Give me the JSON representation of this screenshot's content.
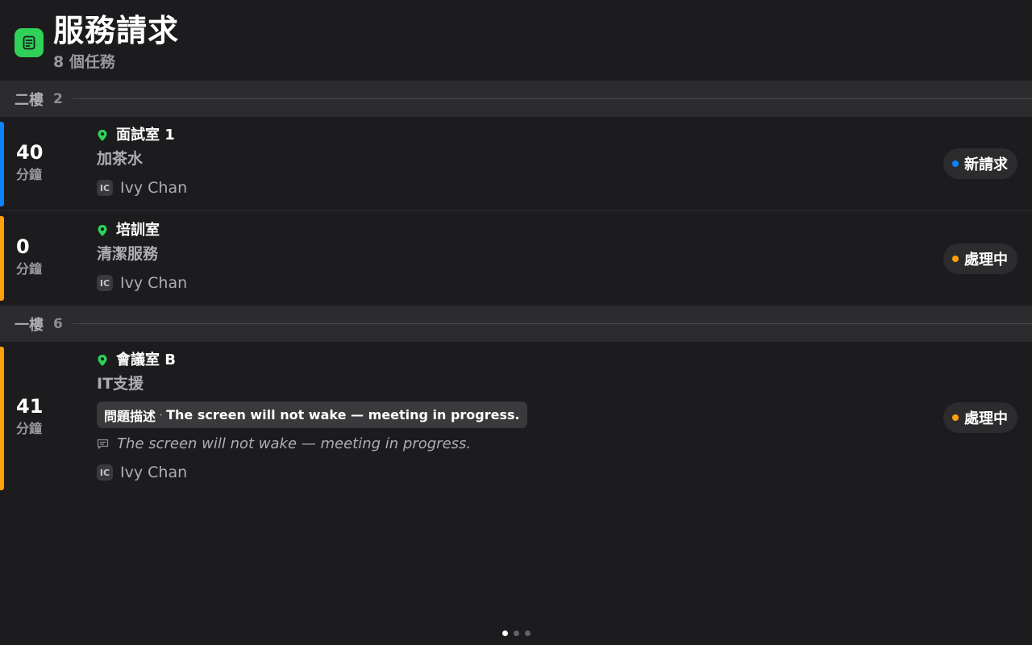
{
  "header": {
    "title": "服務請求",
    "task_count": "8 個任務",
    "icon": "note-icon",
    "icon_color": "#30d158"
  },
  "colors": {
    "new": "#0a84ff",
    "in_progress": "#ff9f0a",
    "location_pin": "#30d158"
  },
  "sections": [
    {
      "name": "二樓",
      "count": "2",
      "rows": [
        {
          "minutes": "40",
          "minutes_unit": "分鐘",
          "location": "面試室 1",
          "service": "加茶水",
          "assignee_initials": "IC",
          "assignee": "Ivy Chan",
          "status": "新請求",
          "status_type": "new"
        },
        {
          "minutes": "0",
          "minutes_unit": "分鐘",
          "location": "培訓室",
          "service": "清潔服務",
          "assignee_initials": "IC",
          "assignee": "Ivy Chan",
          "status": "處理中",
          "status_type": "in_progress"
        }
      ]
    },
    {
      "name": "一樓",
      "count": "6",
      "rows": [
        {
          "minutes": "41",
          "minutes_unit": "分鐘",
          "location": "會議室 B",
          "service": "IT支援",
          "description_label": "問題描述",
          "description_sep": "·",
          "description": "The screen will not wake — meeting in progress.",
          "note": "The screen will not wake — meeting in progress.",
          "assignee_initials": "IC",
          "assignee": "Ivy Chan",
          "status": "處理中",
          "status_type": "in_progress"
        }
      ]
    }
  ],
  "pagination": {
    "pages": 3,
    "current": 1
  }
}
